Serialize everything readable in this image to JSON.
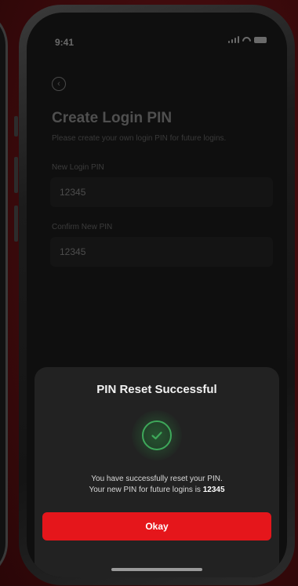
{
  "status_bar": {
    "time": "9:41"
  },
  "page": {
    "title": "Create Login PIN",
    "subtitle": "Please create your own login PIN for future logins.",
    "new_pin_label": "New Login PIN",
    "new_pin_value": "12345",
    "confirm_pin_label": "Confirm New PIN",
    "confirm_pin_value": "12345"
  },
  "sheet": {
    "title": "PIN Reset Successful",
    "message_line1": "You have successfully reset your PIN.",
    "message_line2_prefix": "Your new PIN for future logins is ",
    "message_pin": "12345",
    "okay_label": "Okay"
  },
  "colors": {
    "accent": "#e5161b",
    "success": "#3ea85a",
    "background": "#0f0f0f"
  },
  "icons": {
    "back": "back-arrow-icon",
    "success": "checkmark-icon",
    "signal": "signal-icon",
    "wifi": "wifi-icon",
    "battery": "battery-icon"
  }
}
